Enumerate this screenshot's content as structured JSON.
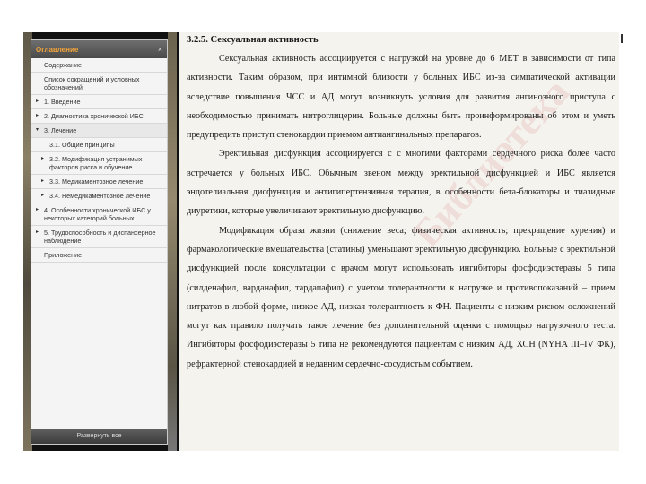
{
  "sidebar": {
    "title": "Оглавление",
    "close": "×",
    "footer": "Развернуть все",
    "items": [
      {
        "label": "Содержание",
        "arrow": "",
        "sub": false
      },
      {
        "label": "Список сокращений и условных обозначений",
        "arrow": "",
        "sub": false
      },
      {
        "label": "1. Введение",
        "arrow": "▸",
        "sub": false
      },
      {
        "label": "2. Диагностика хронической ИБС",
        "arrow": "▸",
        "sub": false
      },
      {
        "label": "3. Лечение",
        "arrow": "▾",
        "sub": false
      },
      {
        "label": "3.1. Общие принципы",
        "arrow": "",
        "sub": true
      },
      {
        "label": "3.2. Модификация устранимых факторов риска и обучение",
        "arrow": "▸",
        "sub": true
      },
      {
        "label": "3.3. Медикаментозное лечение",
        "arrow": "▸",
        "sub": true
      },
      {
        "label": "3.4. Немедикаментозное лечение",
        "arrow": "▸",
        "sub": true
      },
      {
        "label": "4. Особенности хронической ИБС у некоторых категорий больных",
        "arrow": "▸",
        "sub": false
      },
      {
        "label": "5. Трудоспособность и диспансерное наблюдение",
        "arrow": "▸",
        "sub": false
      },
      {
        "label": "Приложение",
        "arrow": "",
        "sub": false
      }
    ]
  },
  "document": {
    "heading": "3.2.5. Сексуальная активность",
    "paragraphs": [
      "Сексуальная активность ассоциируется с нагрузкой на уровне до 6 МЕТ в зависимости от типа активности. Таким образом, при интимной близости у больных ИБС из-за симпатической активации вследствие повышения ЧСС и АД могут возникнуть условия для развития ангинозного приступа с необходимостью принимать нитроглицерин. Больные должны быть проинформированы об этом и уметь предупредить приступ стенокардии приемом антиангинальных препаратов.",
      "Эректильная дисфункция ассоциируется с с многими факторами сердечного риска более часто встречается у больных ИБС. Обычным звеном между эректильной дисфункцией и ИБС является эндотелиальная дисфункция и антигипертензивная терапия, в особенности бета-блокаторы и тиазидные диуретики, которые увеличивают эректильную дисфункцию.",
      "Модификация образа жизни (снижение веса; физическая активность; прекращение курения) и фармакологические вмешательства (статины) уменьшают эректильную дисфункцию. Больные с эректильной дисфункцией после консультации с врачом могут использовать ингибиторы фосфодиэстеразы 5 типа (силденафил, варданафил, тардапафил) с учетом толерантности к нагрузке и противопоказаний – прием нитратов в любой форме, низкое АД, низкая толерантность к ФН. Пациенты с низким риском осложнений могут как правило получать такое лечение без дополнительной оценки с помощью нагрузочного теста. Ингибиторы фосфодиэстеразы 5 типа не рекомендуются пациентам с низким АД, ХСН (NYHA III–IV ФК), рефрактерной стенокардией и недавним сердечно-сосудистым событием."
    ]
  },
  "colors": {
    "accent": "#f4a53a",
    "header": "#4a4a4a",
    "page": "#f5f3ee"
  }
}
